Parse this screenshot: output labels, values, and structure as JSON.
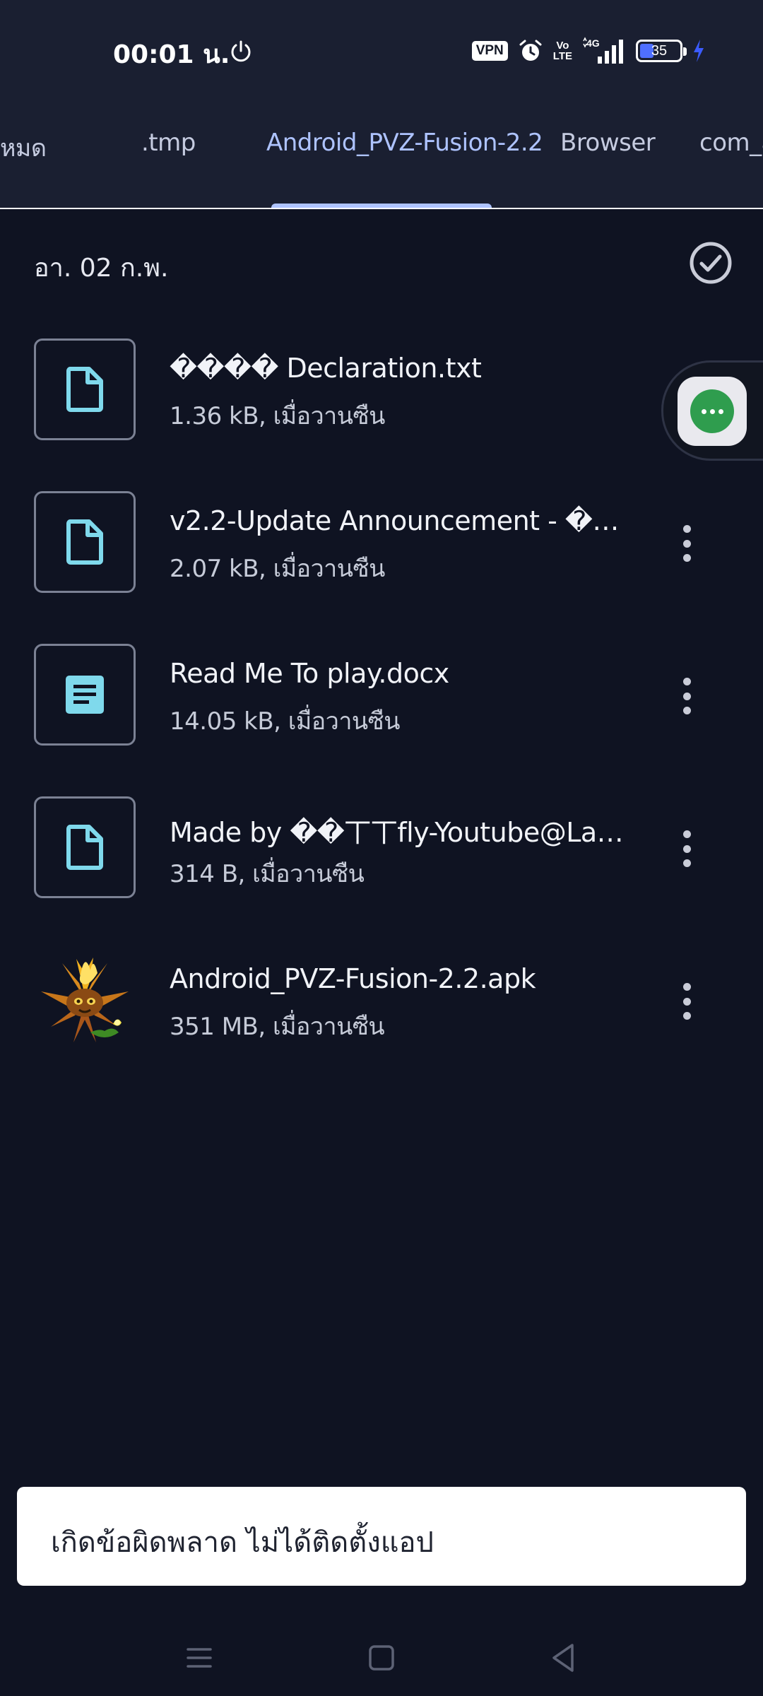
{
  "status_bar": {
    "time": "00:01 น.",
    "vpn_label": "VPN",
    "volte_top": "Vo",
    "volte_bottom": "LTE",
    "network": "4G",
    "battery_level": "35",
    "battery_fraction": 0.35,
    "icons": [
      "power-icon",
      "vpn-badge",
      "alarm-icon",
      "volte-icon",
      "signal-icon",
      "battery-icon",
      "charging-icon"
    ]
  },
  "tabs": [
    {
      "label": "หมด",
      "active": false
    },
    {
      "label": ".tmp",
      "active": false
    },
    {
      "label": "Android_PVZ-Fusion-2.2",
      "active": true
    },
    {
      "label": "Browser",
      "active": false
    },
    {
      "label": "com_ad",
      "active": false
    }
  ],
  "date_header": {
    "label": "อา. 02 ก.พ.",
    "select_icon": "check-circle-icon"
  },
  "files": [
    {
      "name": "���� Declaration.txt",
      "meta": "1.36 kB, เมื่อวานซืน",
      "icon": "file-icon"
    },
    {
      "name": "v2.2-Update Announcement - ���…",
      "meta": "2.07 kB, เมื่อวานซืน",
      "icon": "file-icon"
    },
    {
      "name": "Read Me To play.docx",
      "meta": "14.05 kB, เมื่อวานซืน",
      "icon": "document-icon"
    },
    {
      "name": "Made by ��丅丅fly-Youtube@Lanpia…",
      "meta": "314 B, เมื่อวานซืน",
      "icon": "file-icon"
    },
    {
      "name": "Android_PVZ-Fusion-2.2.apk",
      "meta": "351 MB, เมื่อวานซืน",
      "icon": "app-icon"
    }
  ],
  "toast": {
    "message": "เกิดข้อผิดพลาด ไม่ได้ติดตั้งแอป"
  },
  "colors": {
    "background": "#0f1322",
    "topbar": "#1a1f31",
    "accent": "#aec3ff",
    "file_icon": "#7fd9ec"
  }
}
